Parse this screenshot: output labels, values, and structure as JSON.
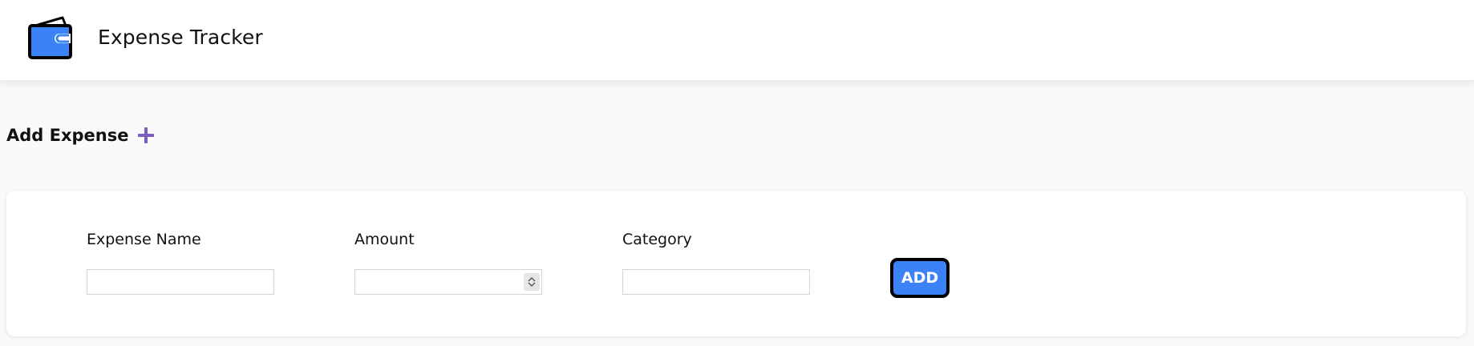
{
  "header": {
    "title": "Expense Tracker",
    "logo_icon": "wallet-icon",
    "logo_colors": {
      "body": "#3b82f6",
      "outline": "#000000",
      "clasp": "#ffffff"
    }
  },
  "section": {
    "title": "Add Expense",
    "icon": "plus-icon",
    "icon_color": "#7c5cbf"
  },
  "form": {
    "fields": [
      {
        "label": "Expense Name",
        "value": "",
        "placeholder": ""
      },
      {
        "label": "Amount",
        "value": "",
        "placeholder": ""
      },
      {
        "label": "Category",
        "value": "",
        "placeholder": ""
      }
    ],
    "submit_label": "ADD",
    "submit_color": "#3b82f6"
  }
}
